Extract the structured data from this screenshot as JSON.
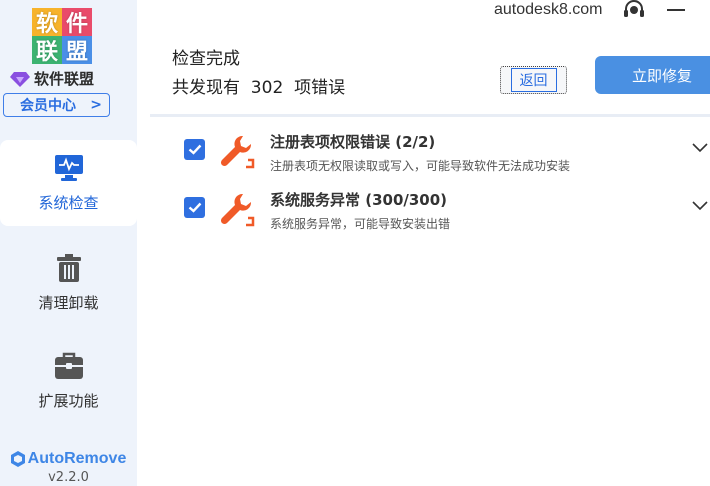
{
  "sidebar": {
    "logo_chars": [
      "软",
      "件",
      "联",
      "盟"
    ],
    "brand_name": "软件联盟",
    "member_center": "会员中心",
    "member_arrow": ">",
    "nav": [
      {
        "label": "系统检查",
        "icon": "monitor-icon",
        "active": true
      },
      {
        "label": "清理卸载",
        "icon": "trash-icon",
        "active": false
      },
      {
        "label": "扩展功能",
        "icon": "toolbox-icon",
        "active": false
      }
    ],
    "product_name": "AutoRemove",
    "version": "v2.2.0"
  },
  "topbar": {
    "site": "autodesk8.com"
  },
  "header": {
    "title": "检查完成",
    "summary": "共发现有  302  项错误",
    "back_button": "返回",
    "fix_button": "立即修复"
  },
  "errors": [
    {
      "title": "注册表项权限错误 (2/2)",
      "description": "注册表项无权限读取或写入，可能导致软件无法成功安装",
      "checked": true
    },
    {
      "title": "系统服务异常 (300/300)",
      "description": "系统服务异常，可能导致安装出错",
      "checked": true
    }
  ],
  "colors": {
    "accent": "#2a6de0",
    "fix_button": "#4a90e2",
    "sidebar_bg": "#eef3fb",
    "wrench": "#f05a28"
  }
}
